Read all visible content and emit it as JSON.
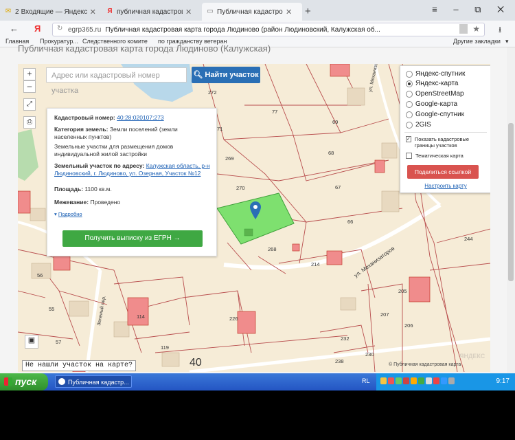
{
  "browser": {
    "tabs": [
      {
        "label": "Входящие — Яндекс.По",
        "badge": "2",
        "icon": "mail-icon"
      },
      {
        "label": "публичная кадастровая ка",
        "icon": "yandex-icon"
      },
      {
        "label": "Публичная кадастровая",
        "icon": "page-icon",
        "active": true
      }
    ],
    "new_tab": "+",
    "window_controls": "≡ – ⧉ ✕",
    "back": "←",
    "yandex_logo": "Я",
    "url_domain": "egrp365.ru",
    "page_title": "Публичная кадастровая карта города Людиново (район Людиновский, Калужская об...",
    "bookmarks": [
      "Главная",
      "Прокуратур...",
      "Следственного комите",
      "по гражданству ветеран"
    ],
    "other_bookmarks": "Другие закладки"
  },
  "page": {
    "heading": "Публичная кадастровая карта города Людиново (Калужская)"
  },
  "map": {
    "zoom_in": "+",
    "zoom_out": "–",
    "search_placeholder": "Адрес или кадастровый номер участка",
    "search_button": "Найти участок",
    "lot_numbers": [
      "272",
      "77",
      "71",
      "69",
      "68",
      "269",
      "270",
      "67",
      "66",
      "268",
      "214",
      "56",
      "55",
      "114",
      "57",
      "226",
      "119",
      "205",
      "207",
      "206",
      "232",
      "230",
      "238",
      "244"
    ],
    "street_labels": [
      "ул. Механизаторов",
      "ул. Механизаторов",
      "Зеленый пер."
    ],
    "big_number": "40",
    "not_found": "Не нашли участок на карте?",
    "copyright": "© Публичная кадастровая карта",
    "watermark": "ЯНДЕКС"
  },
  "info_card": {
    "cad_label": "Кадастровый номер:",
    "cad_value": "40:28:020107:273",
    "cat_label": "Категория земель:",
    "cat_value": "Земли поселений (земли населенных пунктов)",
    "use_value": "Земельные участки для размещения домов индивидуальной жилой застройки",
    "addr_label": "Земельный участок по адресу:",
    "addr_value": "Калужская область, р-н Людиновский, г. Людиново, ул. Озерная, Участок №12",
    "area_label": "Площадь:",
    "area_value": "1100 кв.м.",
    "survey_label": "Межевание:",
    "survey_value": "Проведено",
    "more_link": "Подробно",
    "egrn_button": "Получить выписку из ЕГРН →"
  },
  "layers_panel": {
    "options": [
      "Яндекс-спутник",
      "Яндекс-карта",
      "OpenStreetMap",
      "Google-карта",
      "Google-спутник",
      "2GIS"
    ],
    "selected_index": 1,
    "show_borders": "Показать кадастровые границы участков",
    "thematic": "Тематическая карта",
    "share_button": "Поделиться ссылкой",
    "setup_link": "Настроить карту"
  },
  "taskbar": {
    "start": "пуск",
    "task_label": "Публичная кадастр...",
    "lang": "RL",
    "clock": "9:17"
  },
  "colors": {
    "map_bg": "#f6ecd7",
    "plot_line": "#b84d4d",
    "selected_plot": "#7ee06f",
    "water": "#b8d8ea",
    "pin": "#2a6fb5",
    "button_green": "#3fa843",
    "button_blue": "#2a6fb5",
    "button_red": "#d9534f"
  }
}
